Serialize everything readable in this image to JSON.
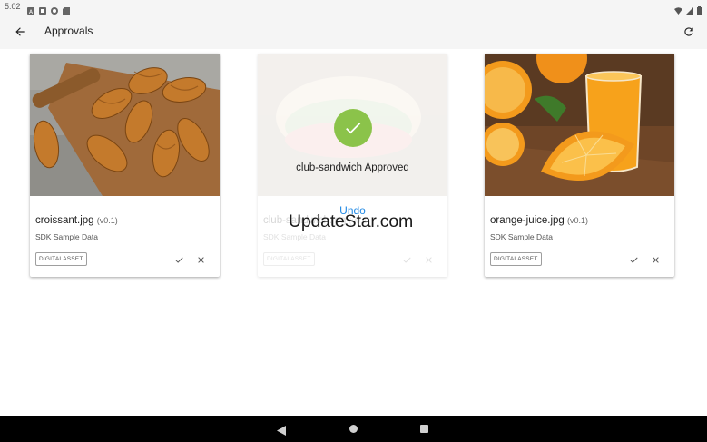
{
  "status_bar": {
    "time": "5:02",
    "left_icons": [
      "notification-a-icon",
      "notification-square-icon",
      "notification-circle-icon",
      "notification-sd-icon"
    ],
    "right_icons": [
      "wifi-icon",
      "signal-icon",
      "battery-icon"
    ]
  },
  "app_bar": {
    "back_icon": "arrow-back-icon",
    "title": "Approvals",
    "refresh_icon": "refresh-icon"
  },
  "cards": [
    {
      "name": "croissant.jpg",
      "version": "(v0.1)",
      "source": "SDK Sample Data",
      "tag": "DIGITALASSET",
      "state": "pending"
    },
    {
      "name": "club-sandwich.jpg",
      "version": "(v0.1)",
      "source": "SDK Sample Data",
      "tag": "DIGITALASSET",
      "state": "approved",
      "approved_message": "club-sandwich Approved",
      "undo_label": "Undo"
    },
    {
      "name": "orange-juice.jpg",
      "version": "(v0.1)",
      "source": "SDK Sample Data",
      "tag": "DIGITALASSET",
      "state": "pending"
    }
  ],
  "watermark": "UpdateStar.com",
  "colors": {
    "approved_green": "#8bc34a",
    "link_blue": "#1e88e5",
    "bar_bg": "#f5f5f5"
  }
}
